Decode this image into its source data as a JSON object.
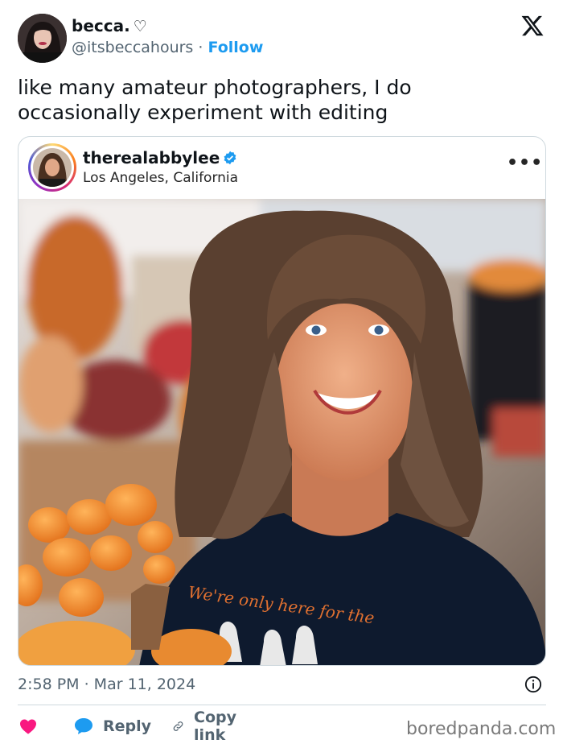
{
  "author": {
    "display_name": "becca.",
    "name_suffix": "♡",
    "handle": "@itsbeccahours",
    "separator": "·",
    "follow_label": "Follow"
  },
  "tweet_text": "like many amateur photographers, I do occasionally experiment with editing",
  "embedded_post": {
    "username": "therealabbylee",
    "location": "Los Angeles, California",
    "more_label": "•••",
    "shirt_text": "We're only here for the"
  },
  "timestamp": "2:58 PM · Mar 11, 2024",
  "actions": {
    "reply_label": "Reply",
    "copy_link_label": "Copy link"
  },
  "watermark": "boredpanda.com",
  "colors": {
    "accent": "#1d9bf0",
    "like": "#f91880",
    "text": "#0f1419",
    "muted": "#536471",
    "border": "#cfd9de"
  },
  "icons": [
    "x-logo-icon",
    "verified-badge-icon",
    "more-icon",
    "info-icon",
    "heart-icon",
    "reply-bubble-icon",
    "link-icon"
  ]
}
